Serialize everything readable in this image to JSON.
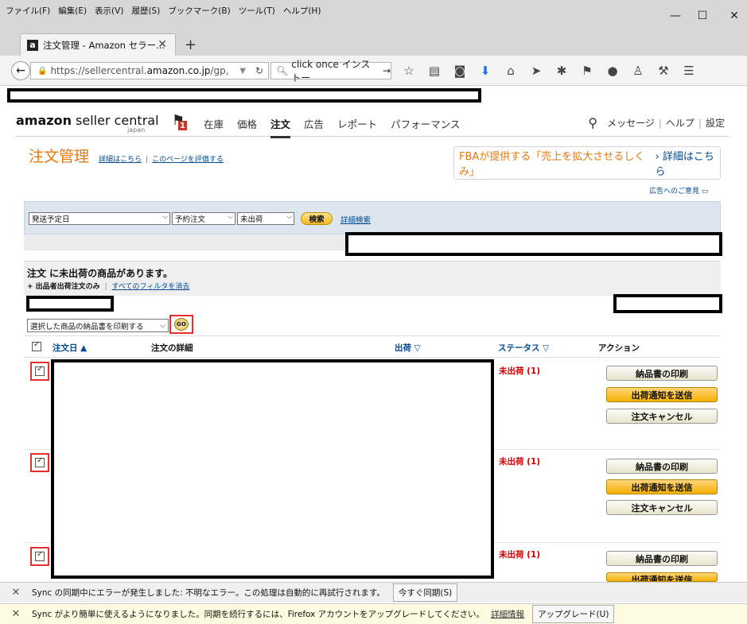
{
  "menubar": {
    "items": [
      "ファイル(F)",
      "編集(E)",
      "表示(V)",
      "履歴(S)",
      "ブックマーク(B)",
      "ツール(T)",
      "ヘルプ(H)"
    ],
    "window_controls": [
      "—",
      "☐",
      "✕"
    ]
  },
  "tab": {
    "favicon": "a",
    "title": "注文管理 - Amazon セラー...",
    "close": "✕",
    "new_tab": "+"
  },
  "navbar": {
    "url_prefix": "https://sellercentral.",
    "url_domain": "amazon.co.jp",
    "url_suffix": "/gp,",
    "search_text": "click once インストー",
    "icons": [
      "star-icon",
      "reading-list-icon",
      "pocket-icon",
      "download-icon",
      "home-icon",
      "send-icon",
      "extension-icon",
      "translate-icon",
      "chat-icon",
      "account-icon",
      "tool-icon",
      "menu-icon"
    ]
  },
  "amazon": {
    "logo_main": "amazon",
    "logo_sub": " seller central",
    "logo_region": "japan",
    "flag_count": "1",
    "nav": [
      "在庫",
      "価格",
      "注文",
      "広告",
      "レポート",
      "パフォーマンス"
    ],
    "nav_active": "注文",
    "right_links": [
      "メッセージ",
      "ヘルプ",
      "設定"
    ]
  },
  "page": {
    "title": "注文管理",
    "link_details": "詳細はこちら",
    "link_rate": "このページを評価する",
    "fba_text": "FBAが提供する「売上を拡大させるしくみ」",
    "fba_link": "› 詳細はこちら",
    "ad_feedback": "広告へのご意見"
  },
  "filters": {
    "date_filter": "発送予定日",
    "preorder": "予約注文",
    "status": "未出荷",
    "search_button": "検索",
    "advanced_search": "詳細検索"
  },
  "alert": {
    "heading": "注文 に未出荷の商品があります。",
    "filter_applied": "+ 出品者出荷注文のみ",
    "clear_filters": "すべてのフィルタを消去"
  },
  "bulk": {
    "action": "選択した商品の納品書を印刷する",
    "go": "GO"
  },
  "table": {
    "headers": {
      "order_date": "注文日 ▲",
      "details": "注文の詳細",
      "shipping": "出荷 ▽",
      "status": "ステータス ▽",
      "action": "アクション"
    },
    "rows": [
      {
        "status": "未出荷 (1)",
        "actions": [
          "納品書の印刷",
          "出荷通知を送信",
          "注文キャンセル"
        ]
      },
      {
        "status": "未出荷 (1)",
        "actions": [
          "納品書の印刷",
          "出荷通知を送信",
          "注文キャンセル"
        ]
      },
      {
        "status": "未出荷 (1)",
        "actions": [
          "納品書の印刷",
          "出荷通知を送信"
        ]
      }
    ]
  },
  "notifications": [
    {
      "text": "Sync の同期中にエラーが発生しました: 不明なエラー。この処理は自動的に再試行されます。",
      "button": "今すぐ同期(S)"
    },
    {
      "text": "Sync がより簡単に使えるようになりました。同期を続行するには、Firefox アカウントをアップグレードしてください。",
      "link": "詳細情報",
      "button": "アップグレード(U)"
    }
  ],
  "colors": {
    "accent_orange": "#e47911",
    "link_blue": "#004b91",
    "status_red": "#d30000",
    "notif_gray": "#f0f0f0",
    "notif_yellow": "#fdfbe0"
  }
}
